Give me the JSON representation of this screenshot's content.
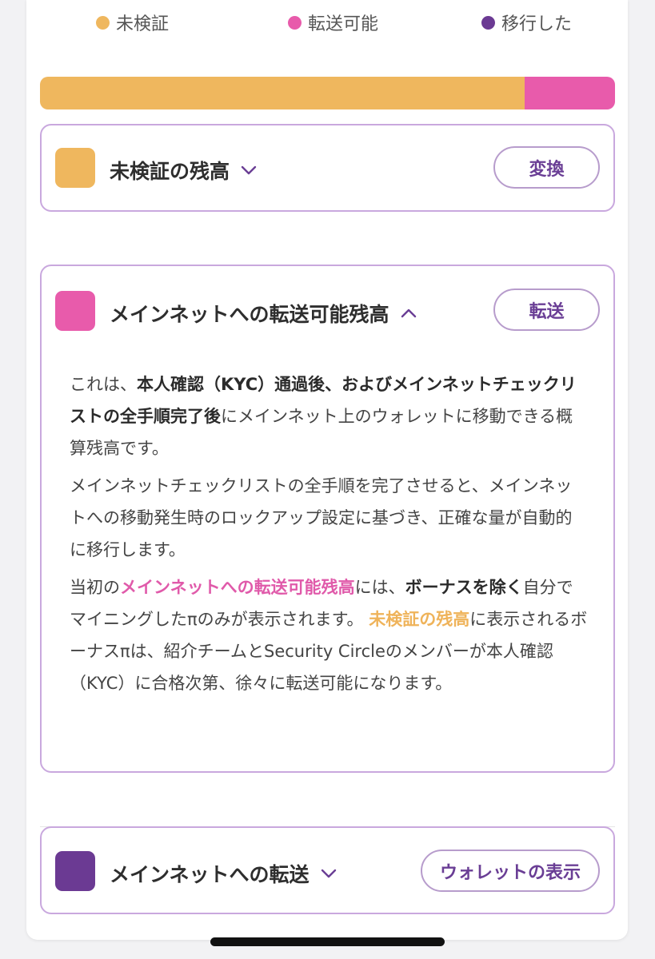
{
  "legend": [
    {
      "label": "未検証",
      "color": "#efb75e"
    },
    {
      "label": "転送可能",
      "color": "#e85bab"
    },
    {
      "label": "移行した",
      "color": "#6b3a93"
    }
  ],
  "balance_bar": [
    {
      "name": "未検証",
      "fraction": 0.843,
      "color": "#efb75e"
    },
    {
      "name": "転送可能",
      "fraction": 0.157,
      "color": "#e85bab"
    }
  ],
  "unverified_card": {
    "title": "未検証の残高",
    "button_label": "変換",
    "color": "#efb75e",
    "expanded": false
  },
  "transferable_card": {
    "title": "メインネットへの転送可能残高",
    "button_label": "転送",
    "color": "#e85bab",
    "expanded": true,
    "p1": {
      "t1": "これは、",
      "b1": "本人確認（KYC）通過後、およびメインネットチェックリストの全手順完了後",
      "t2": "にメインネット上のウォレットに移動できる概算残高です。"
    },
    "p2": "メインネットチェックリストの全手順を完了させると、メインネットへの移動発生時のロックアップ設定に基づき、正確な量が自動的に移行します。",
    "p3": {
      "t1": "当初の",
      "pink": "メインネットへの転送可能残高",
      "t2": "には、",
      "b1": "ボーナスを除く",
      "t3": "自分でマイニングしたπのみが表示されます。",
      "orange": "未検証の残高",
      "t4": "に表示されるボーナスπは、紹介チームとSecurity Circleのメンバーが本人確認（KYC）に合格次第、徐々に転送可能になります。"
    }
  },
  "mainnet_card": {
    "title": "メインネットへの転送",
    "button_label": "ウォレットの表示",
    "color": "#6b3a93",
    "expanded": false
  }
}
